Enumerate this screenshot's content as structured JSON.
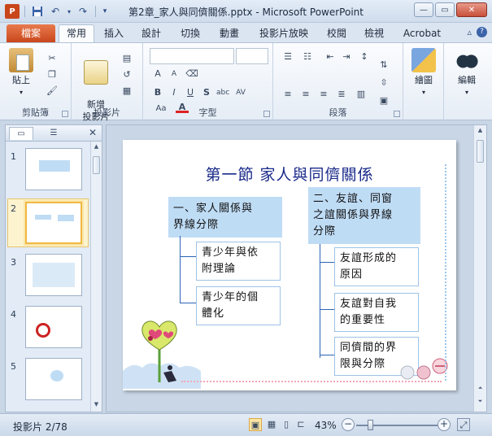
{
  "window": {
    "title": "第2章_家人與同儕關係.pptx - Microsoft PowerPoint"
  },
  "tabs": {
    "file": "檔案",
    "items": [
      "常用",
      "插入",
      "設計",
      "切換",
      "動畫",
      "投影片放映",
      "校閱",
      "檢視",
      "Acrobat"
    ],
    "active": "常用"
  },
  "ribbon": {
    "groups": {
      "clipboard": {
        "label": "剪貼簿",
        "paste": "貼上"
      },
      "slides": {
        "label": "投影片",
        "new_slide": "新增\n投影片"
      },
      "font": {
        "label": "字型"
      },
      "paragraph": {
        "label": "段落"
      },
      "drawing": {
        "drawing": "繪圖"
      },
      "editing": {
        "editing": "編輯"
      }
    },
    "font_icons": [
      "B",
      "I",
      "U",
      "S",
      "abc",
      "AV",
      "Aa",
      "A",
      "A"
    ]
  },
  "thumbnail_pane": {
    "slides": [
      {
        "number": "1"
      },
      {
        "number": "2"
      },
      {
        "number": "3"
      },
      {
        "number": "4"
      },
      {
        "number": "5"
      }
    ],
    "selected": "2"
  },
  "slide": {
    "title": "第一節 家人與同儕關係",
    "left_head": "一、家人關係與\n界線分際",
    "left_items": [
      "青少年與依\n附理論",
      "青少年的個\n體化"
    ],
    "right_head": "二、友誼、同窗\n之誼關係與界線\n分際",
    "right_items": [
      "友誼形成的\n原因",
      "友誼對自我\n的重要性",
      "同儕間的界\n限與分際"
    ]
  },
  "status": {
    "counter": "投影片 2/78",
    "zoom": "43%",
    "zoom_fraction": 0.43
  },
  "colors": {
    "title_blue": "#1a2a8a",
    "header_fill": "#bfdcf5",
    "connector": "#2b63b5",
    "file_tab": "#d65a2b"
  }
}
